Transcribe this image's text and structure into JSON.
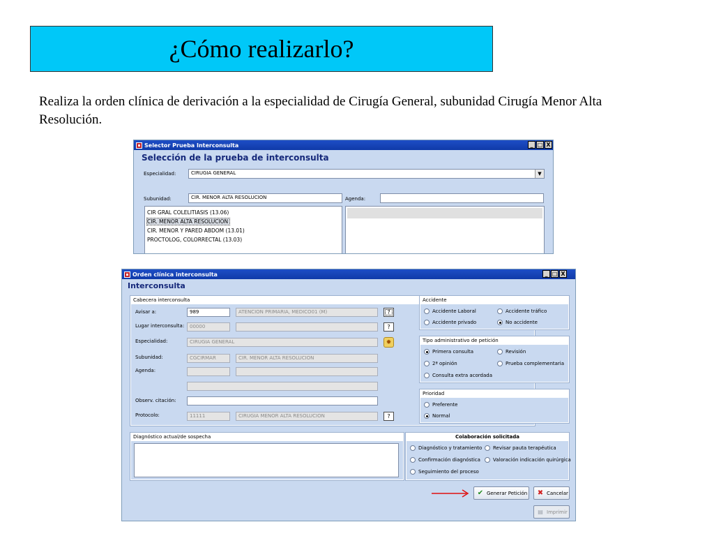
{
  "slide": {
    "title": "¿Cómo realizarlo?",
    "description": "Realiza la orden clínica de derivación a la especialidad de Cirugía General, subunidad Cirugía Menor Alta Resolución."
  },
  "selector_window": {
    "title": "Selector Prueba Interconsulta",
    "heading": "Selección de la prueba de interconsulta",
    "especialidad_label": "Especialidad:",
    "especialidad_value": "CIRUGIA GENERAL",
    "subunidad_label": "Subunidad:",
    "subunidad_value": "CIR. MENOR ALTA RESOLUCION",
    "agenda_label": "Agenda:",
    "agenda_value": "",
    "list": [
      "CIR GRAL COLELITIASIS (13.06)",
      "CIR. MENOR ALTA RESOLUCION",
      "CIR. MENOR Y PARED ABDOM (13.01)",
      "PROCTOLOG, COLORRECTAL (13.03)"
    ],
    "controls": [
      "_",
      "□",
      "X"
    ]
  },
  "orden_window": {
    "title": "Orden clínica interconsulta",
    "heading": "Interconsulta",
    "controls": [
      "_",
      "□",
      "X"
    ],
    "cabecera": {
      "title": "Cabecera interconsulta",
      "avisar_label": "Avisar a:",
      "avisar_code": "989",
      "avisar_name": "ATENCION PRIMARIA, MEDICO01 (M)",
      "lugar_label": "Lugar interconsulta:",
      "lugar_code": "00000",
      "lugar_name": "",
      "especialidad_label": "Especialidad:",
      "especialidad_value": "CIRUGIA GENERAL",
      "subunidad_label": "Subunidad:",
      "subunidad_code": "CGCIRMAR",
      "subunidad_name": "CIR. MENOR ALTA RESOLUCION",
      "agenda_label": "Agenda:",
      "agenda_code": "",
      "agenda_name": "",
      "agenda_extra": "",
      "observ_label": "Observ. citación:",
      "observ_value": "",
      "protocolo_label": "Protocolo:",
      "protocolo_code": "11111",
      "protocolo_name": "CIRUGIA MENOR ALTA RESOLUCION",
      "help_glyph": "?"
    },
    "diagnostico": {
      "title": "Diagnóstico actual/de sospecha",
      "value": ""
    },
    "accidente": {
      "title": "Accidente",
      "options": [
        "Accidente Laboral",
        "Accidente tráfico",
        "Accidente privado",
        "No accidente"
      ],
      "selected": "No accidente"
    },
    "tipo_peticion": {
      "title": "Tipo administrativo de petición",
      "options": [
        "Primera consulta",
        "Revisión",
        "2ª opinión",
        "Prueba complementaria",
        "Consulta extra acordada"
      ],
      "selected": "Primera consulta"
    },
    "prioridad": {
      "title": "Prioridad",
      "options": [
        "Preferente",
        "Normal"
      ],
      "selected": "Normal"
    },
    "colaboracion": {
      "title": "Colaboración solicitada",
      "options": [
        "Diagnóstico y tratamiento",
        "Revisar pauta terapéutica",
        "Confirmación diagnóstica",
        "Valoración indicación quirúrgica",
        "Seguimiento del proceso"
      ]
    },
    "buttons": {
      "generar": "Generar Petición",
      "cancelar": "Cancelar",
      "imprimir": "Imprimir"
    }
  },
  "colors": {
    "title_bg": "#00c8f8",
    "window_bg": "#c9d9f0",
    "titlebar": "#1e4ec6",
    "heading": "#15287a",
    "arrow": "#e01010"
  }
}
